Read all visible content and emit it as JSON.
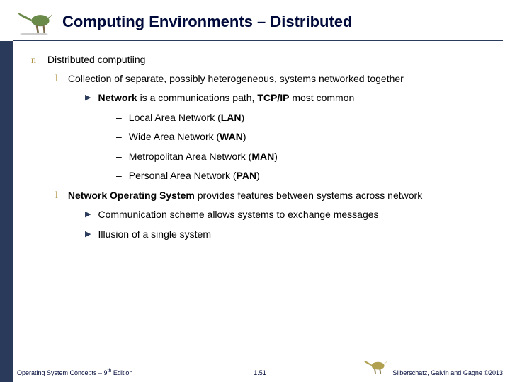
{
  "title": "Computing Environments – Distributed",
  "outline": {
    "lvl1": "Distributed computiing",
    "lvl2a": "Collection of separate, possibly heterogeneous, systems networked together",
    "lvl3a_prefix": "Network",
    "lvl3a_rest": " is a communications path, ",
    "lvl3a_bold2": "TCP/IP",
    "lvl3a_tail": " most common",
    "lvl4a_pre": "Local Area Network (",
    "lvl4a_b": "LAN",
    "lvl4a_post": ")",
    "lvl4b_pre": "Wide Area Network (",
    "lvl4b_b": "WAN",
    "lvl4b_post": ")",
    "lvl4c_pre": "Metropolitan Area Network (",
    "lvl4c_b": "MAN",
    "lvl4c_post": ")",
    "lvl4d_pre": "Personal Area Network (",
    "lvl4d_b": "PAN",
    "lvl4d_post": ")",
    "lvl2b_b": "Network Operating System",
    "lvl2b_rest": " provides features between systems across network",
    "lvl3b": "Communication scheme allows systems to exchange messages",
    "lvl3c": "Illusion of a single system"
  },
  "footer": {
    "left_pre": "Operating System Concepts – 9",
    "left_sup": "th",
    "left_post": " Edition",
    "center": "1.51",
    "right": "Silberschatz, Galvin and Gagne ©2013"
  }
}
